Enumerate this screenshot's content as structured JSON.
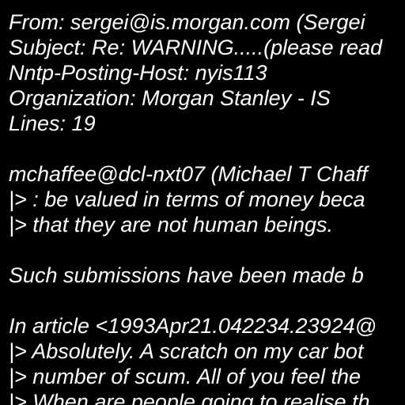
{
  "colors": {
    "background": "#000000",
    "text": "#ffffff"
  },
  "document": {
    "lines": [
      "From: sergei@is.morgan.com (Sergei",
      "Subject: Re: WARNING.....(please read",
      "Nntp-Posting-Host: nyis113",
      "Organization: Morgan Stanley - IS",
      "Lines: 19",
      "",
      "mchaffee@dcl-nxt07 (Michael T Chaff",
      "|> : be valued in terms of money beca",
      "|> that they are not human beings.",
      "",
      "Such submissions have been made b",
      "",
      "In article <1993Apr21.042234.23924@",
      "|> Absolutely. A scratch on my car bot",
      "|> number of scum. All of you feel the",
      "|> When are people going to realise th"
    ]
  }
}
